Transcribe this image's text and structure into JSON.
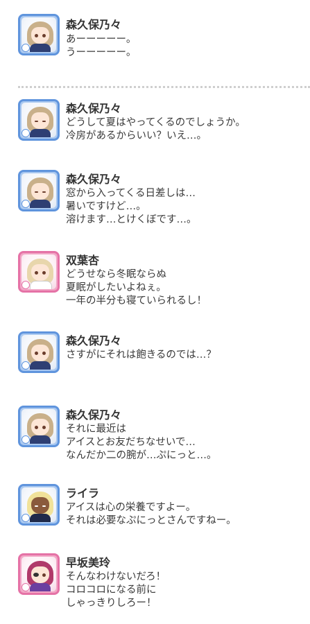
{
  "conversation": [
    {
      "speaker": "森久保乃々",
      "avatar": "morikubo-nono-avatar",
      "type": "cool",
      "lines": [
        "あーーーーー。",
        "うーーーーー。"
      ]
    },
    {
      "speaker": "森久保乃々",
      "avatar": "morikubo-nono-sleepy-avatar",
      "type": "cool",
      "lines": [
        "どうして夏はやってくるのでしょうか。",
        "冷房があるからいい？いえ…。"
      ]
    },
    {
      "speaker": "森久保乃々",
      "avatar": "morikubo-nono-sleepy-avatar",
      "type": "cool",
      "lines": [
        "窓から入ってくる日差しは…",
        "暑いですけど…。",
        "溶けます…とけくぼです…。"
      ]
    },
    {
      "speaker": "双葉杏",
      "avatar": "futaba-anzu-avatar",
      "type": "cute",
      "lines": [
        "どうせなら冬眠ならぬ",
        "夏眠がしたいよねぇ。",
        "一年の半分も寝ていられるし！"
      ]
    },
    {
      "speaker": "森久保乃々",
      "avatar": "morikubo-nono-avatar",
      "type": "cool",
      "lines": [
        "さすがにそれは飽きるのでは…？"
      ]
    },
    {
      "speaker": "森久保乃々",
      "avatar": "morikubo-nono-avatar",
      "type": "cool",
      "lines": [
        "それに最近は",
        "アイスとお友だちなせいで…",
        "なんだか二の腕が…ぷにっと…。"
      ]
    },
    {
      "speaker": "ライラ",
      "avatar": "layla-avatar",
      "type": "cool",
      "lines": [
        "アイスは心の栄養ですよー。",
        "それは必要なぷにっとさんですねー。"
      ]
    },
    {
      "speaker": "早坂美玲",
      "avatar": "hayasaka-mirei-avatar",
      "type": "cute",
      "lines": [
        "そんなわけないだろ！",
        "コロコロになる前に",
        "しゃっきりしろー！"
      ]
    }
  ],
  "colors": {
    "cool_frame": "#5f94dd",
    "cute_frame": "#e572a6",
    "divider": "#cfcfcf"
  }
}
